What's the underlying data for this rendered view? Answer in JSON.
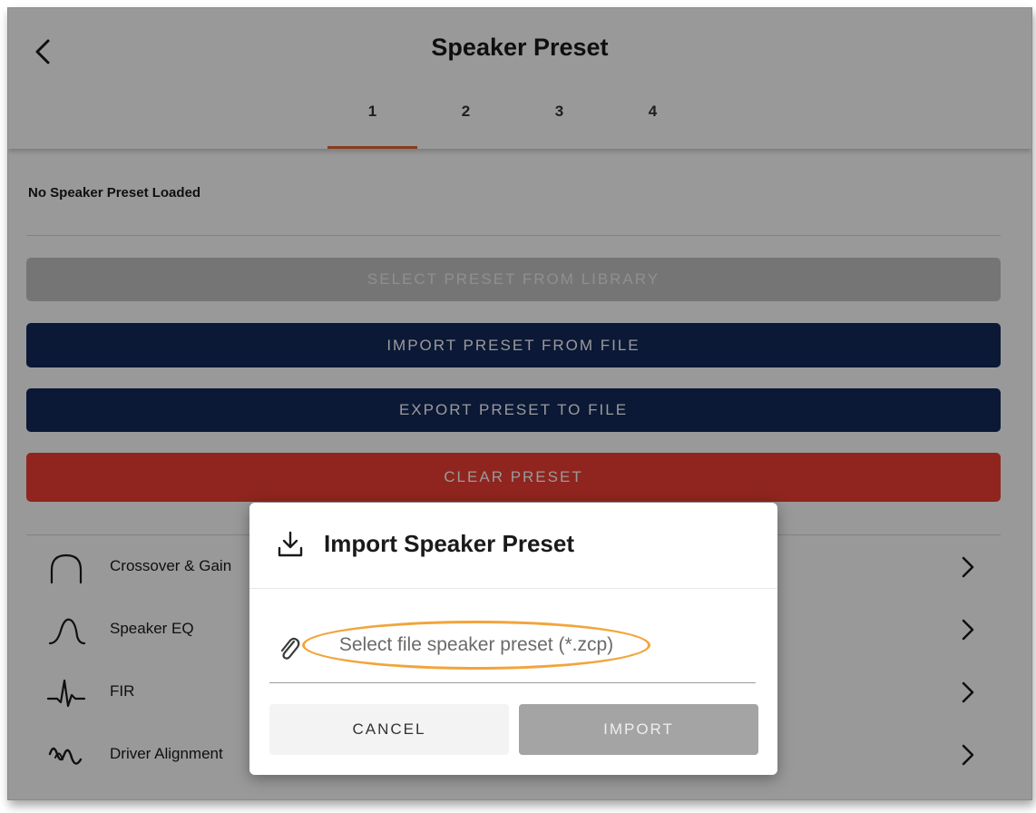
{
  "header": {
    "title": "Speaker Preset",
    "tabs": [
      {
        "label": "1",
        "active": true
      },
      {
        "label": "2",
        "active": false
      },
      {
        "label": "3",
        "active": false
      },
      {
        "label": "4",
        "active": false
      }
    ]
  },
  "status": {
    "text": "No Speaker Preset Loaded"
  },
  "actions": {
    "library_label": "SELECT PRESET FROM LIBRARY",
    "import_label": "IMPORT PRESET FROM FILE",
    "export_label": "EXPORT PRESET TO FILE",
    "clear_label": "CLEAR PRESET"
  },
  "menu": {
    "items": [
      {
        "label": "Crossover & Gain",
        "icon": "crossover-curve-icon"
      },
      {
        "label": "Speaker EQ",
        "icon": "eq-curve-icon"
      },
      {
        "label": "FIR",
        "icon": "fir-waveform-icon"
      },
      {
        "label": "Driver Alignment",
        "icon": "alignment-wave-icon"
      }
    ]
  },
  "dialog": {
    "title": "Import Speaker Preset",
    "icon": "download-icon",
    "file_placeholder": "Select file speaker preset (*.zcp)",
    "file_value": "",
    "cancel_label": "CANCEL",
    "confirm_label": "IMPORT"
  },
  "colors": {
    "accent": "#e2653a",
    "primary": "#13285a",
    "danger": "#ef3e33",
    "highlight": "#f2a43a"
  }
}
